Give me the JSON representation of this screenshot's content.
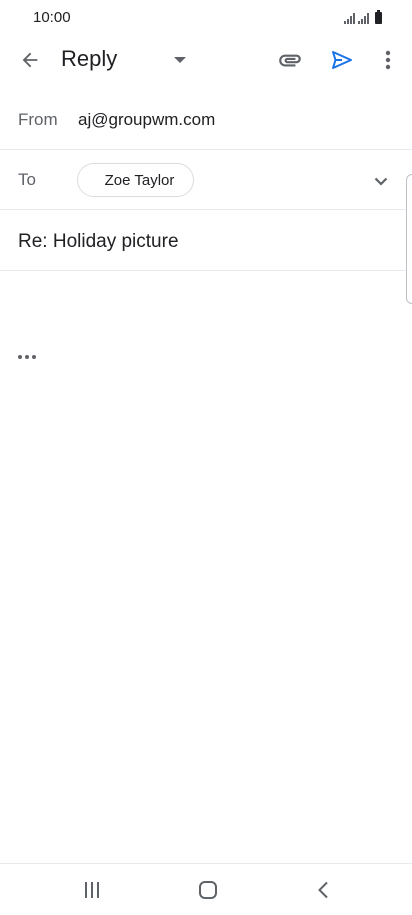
{
  "status_bar": {
    "time": "10:00"
  },
  "app_bar": {
    "title": "Reply",
    "icons": {
      "back": "arrow-back-icon",
      "dropdown": "caret-down-icon",
      "attach": "paperclip-icon",
      "send": "send-icon",
      "more": "more-vert-icon"
    }
  },
  "compose": {
    "from_label": "From",
    "from_value": "aj@groupwm.com",
    "to_label": "To",
    "to_recipient": "Zoe Taylor",
    "subject": "Re: Holiday picture"
  },
  "colors": {
    "accent": "#1a73e8",
    "icon": "#5f6368",
    "text": "#202124",
    "divider": "#e8eaed"
  }
}
